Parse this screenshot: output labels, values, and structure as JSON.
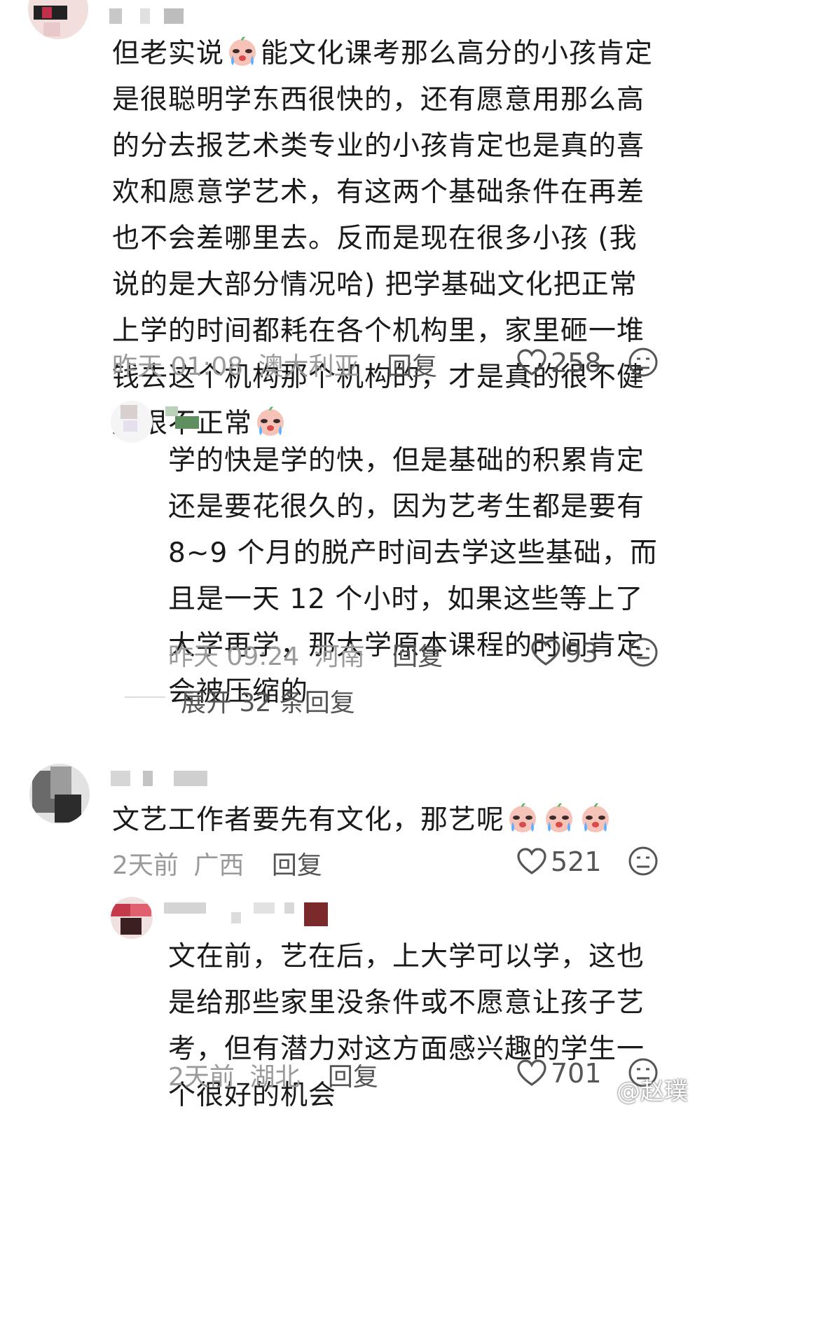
{
  "comments": [
    {
      "text_line1": "但老实说",
      "text_rest": "能文化课考那么高分的小孩肯定是很聪明学东西很快的，还有愿意用那么高的分去报艺术类专业的小孩肯定也是真的喜欢和愿意学艺术，有这两个基础条件在再差也不会差哪里去。反而是现在很多小孩 (我说的是大部分情况哈) 把学基础文化把正常上学的时间都耗在各个机构里，家里砸一堆钱去这个机构那个机构的，才是真的很不健康很不正常",
      "time": "昨天 01:08",
      "location": "澳大利亚",
      "reply_label": "回复",
      "likes": "258",
      "reply": {
        "text": "学的快是学的快，但是基础的积累肯定还是要花很久的，因为艺考生都是要有 8~9 个月的脱产时间去学这些基础，而且是一天 12 个小时，如果这些等上了大学再学，那大学原本课程的时间肯定会被压缩的",
        "time": "昨天 09:24",
        "location": "河南",
        "reply_label": "回复",
        "likes": "93"
      },
      "expand_label": "展开 32 条回复"
    },
    {
      "text": "文艺工作者要先有文化，那艺呢",
      "time": "2天前",
      "location": "广西",
      "reply_label": "回复",
      "likes": "521",
      "reply": {
        "text": "文在前，艺在后，上大学可以学，这也是给那些家里没条件或不愿意让孩子艺考，但有潜力对这方面感兴趣的学生一个很好的机会",
        "time": "2天前",
        "location": "湖北",
        "reply_label": "回复",
        "likes": "701"
      }
    }
  ],
  "emoji_name": "crying-face-emoji",
  "watermark": "@赵璞",
  "colors": {
    "meta": "#9a9a9a",
    "text": "#1a1a1a",
    "icon": "#555555"
  }
}
